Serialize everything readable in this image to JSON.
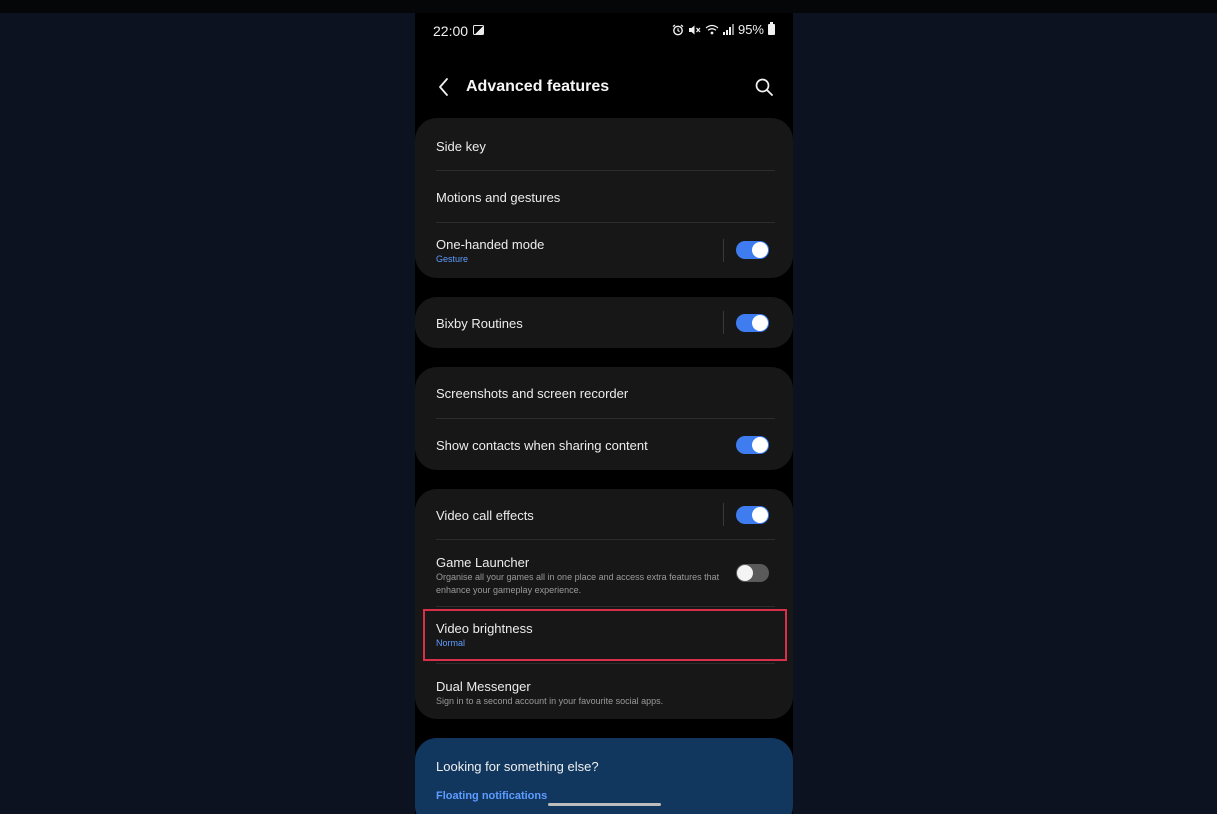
{
  "status_bar": {
    "time": "22:00",
    "battery": "95%",
    "icons": [
      "gallery-icon",
      "alarm-icon",
      "mute-icon",
      "wifi-icon",
      "signal-icon",
      "battery-icon"
    ]
  },
  "header": {
    "title": "Advanced features",
    "back_icon": "chevron-left-icon",
    "search_icon": "search-icon"
  },
  "groups": [
    {
      "items": [
        {
          "title": "Side key"
        },
        {
          "title": "Motions and gestures"
        },
        {
          "title": "One-handed mode",
          "subtitle": "Gesture",
          "toggle": true
        }
      ]
    },
    {
      "items": [
        {
          "title": "Bixby Routines",
          "toggle": true
        }
      ]
    },
    {
      "items": [
        {
          "title": "Screenshots and screen recorder"
        },
        {
          "title": "Show contacts when sharing content",
          "toggle": true
        }
      ]
    },
    {
      "items": [
        {
          "title": "Video call effects",
          "toggle": true
        },
        {
          "title": "Game Launcher",
          "description": "Organise all your games all in one place and access extra features that enhance your gameplay experience.",
          "toggle": false
        },
        {
          "title": "Video brightness",
          "subtitle": "Normal"
        },
        {
          "title": "Dual Messenger",
          "description": "Sign in to a second account in your favourite social apps."
        }
      ]
    }
  ],
  "looking": {
    "title": "Looking for something else?",
    "link": "Floating notifications"
  },
  "colors": {
    "accent": "#3e7cf0",
    "subtitle_blue": "#5f9cff",
    "highlight_red": "#d9304a",
    "card_bg": "#171717",
    "looking_bg": "#11375f"
  }
}
